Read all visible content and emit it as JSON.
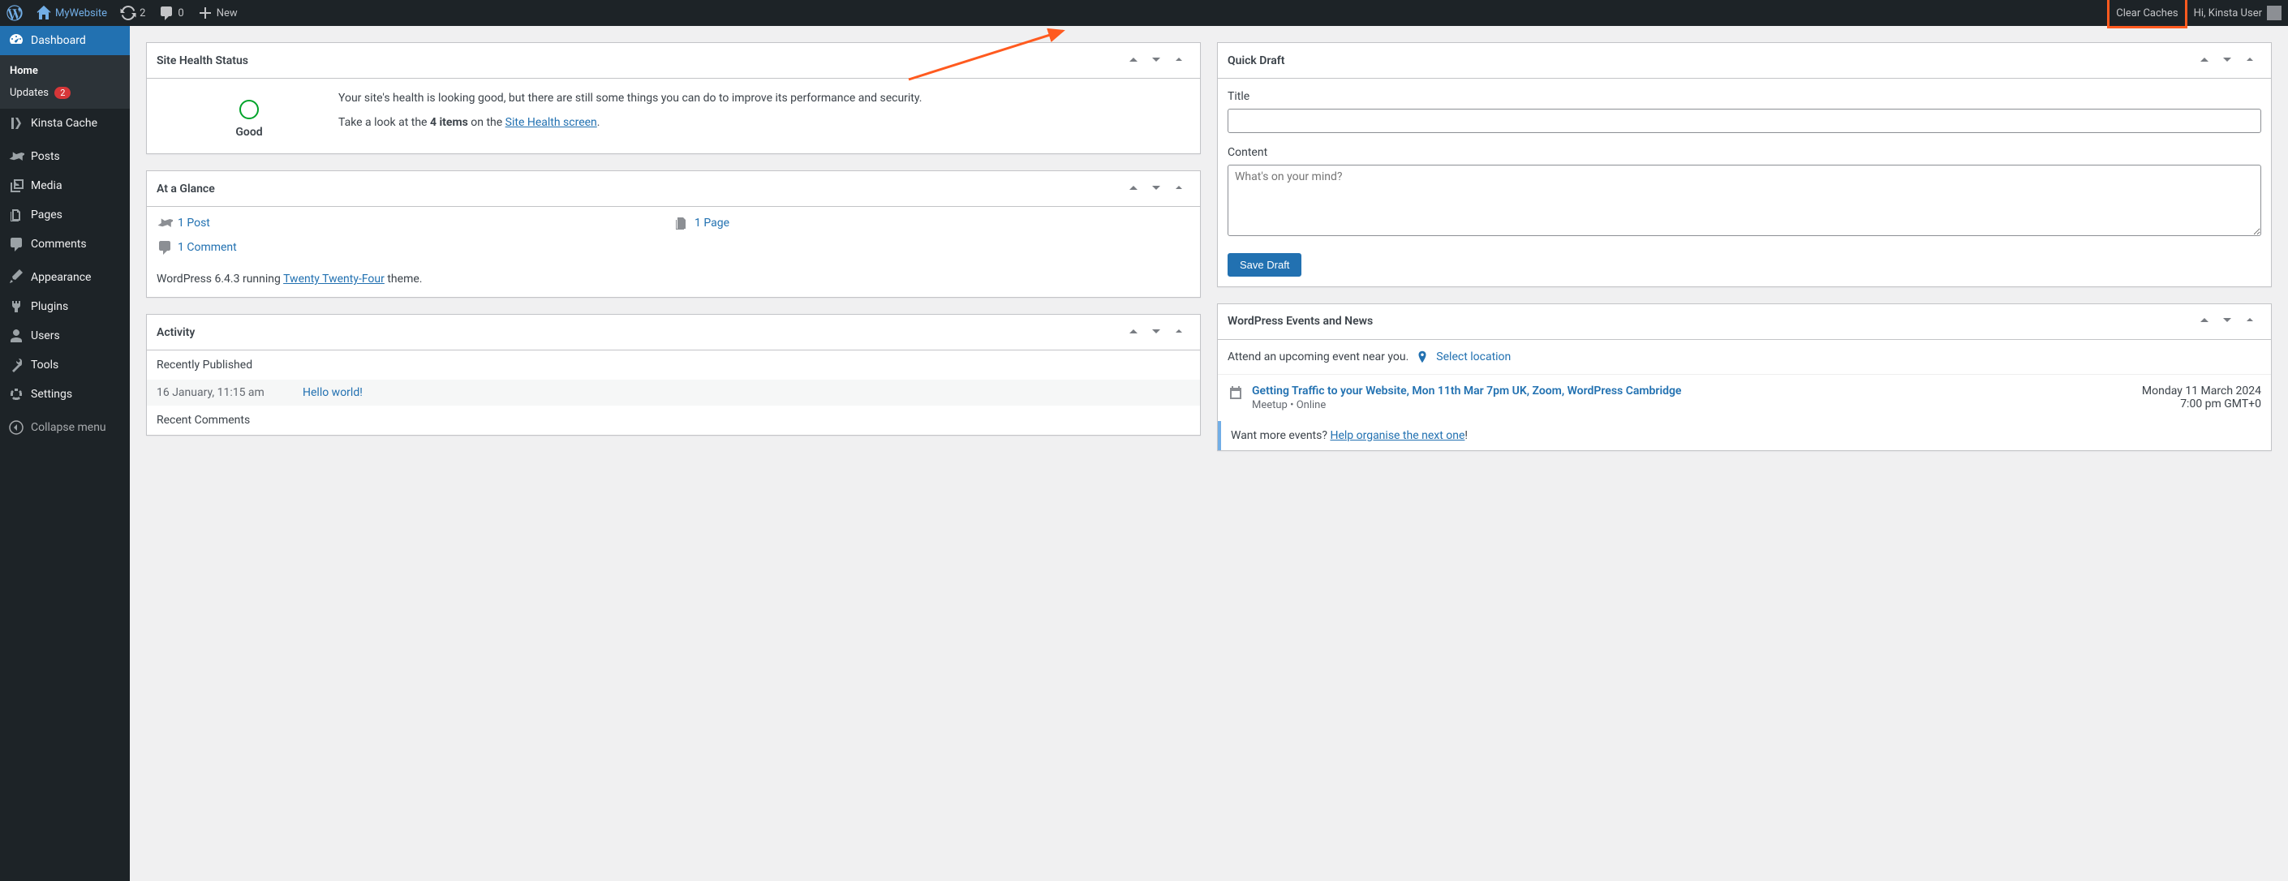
{
  "adminbar": {
    "site_name": "MyWebsite",
    "updates_count": "2",
    "comments_count": "0",
    "new_label": "New",
    "clear_caches": "Clear Caches",
    "greeting": "Hi, Kinsta User"
  },
  "sidebar": {
    "dashboard": "Dashboard",
    "home": "Home",
    "updates": "Updates",
    "updates_badge": "2",
    "kinsta_cache": "Kinsta Cache",
    "posts": "Posts",
    "media": "Media",
    "pages": "Pages",
    "comments": "Comments",
    "appearance": "Appearance",
    "plugins": "Plugins",
    "users": "Users",
    "tools": "Tools",
    "settings": "Settings",
    "collapse": "Collapse menu"
  },
  "site_health": {
    "title": "Site Health Status",
    "status": "Good",
    "desc": "Your site's health is looking good, but there are still some things you can do to improve its performance and security.",
    "look_prefix": "Take a look at the ",
    "items_bold": "4 items",
    "look_mid": " on the ",
    "screen_link": "Site Health screen",
    "period": "."
  },
  "glance": {
    "title": "At a Glance",
    "posts": "1 Post",
    "pages": "1 Page",
    "comments": "1 Comment",
    "wp_prefix": "WordPress 6.4.3 running ",
    "theme": "Twenty Twenty-Four",
    "wp_suffix": " theme."
  },
  "activity": {
    "title": "Activity",
    "recently_published": "Recently Published",
    "post_date": "16 January, 11:15 am",
    "post_title": "Hello world!",
    "recent_comments": "Recent Comments"
  },
  "quick_draft": {
    "title": "Quick Draft",
    "title_label": "Title",
    "content_label": "Content",
    "content_placeholder": "What's on your mind?",
    "save_button": "Save Draft"
  },
  "events": {
    "title": "WordPress Events and News",
    "attend": "Attend an upcoming event near you.",
    "select_location": "Select location",
    "event_title": "Getting Traffic to your Website, Mon 11th Mar 7pm UK, Zoom, WordPress Cambridge",
    "event_meta": "Meetup • Online",
    "event_date": "Monday 11 March 2024",
    "event_time": "7:00 pm GMT+0",
    "more_prefix": "Want more events? ",
    "more_link": "Help organise the next one",
    "more_suffix": "!"
  }
}
